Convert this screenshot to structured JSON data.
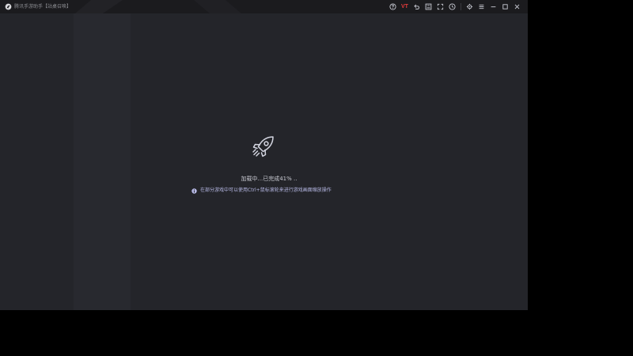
{
  "window": {
    "title": "腾讯手游助手【站桌召唤】",
    "colors": {
      "background": "#24252a",
      "title_bar": "#1b1b1e",
      "side_panel": "#28292f",
      "icon": "#c9cbd4",
      "vt_accent": "#e23b3b",
      "tip": "#b6b8e4"
    }
  },
  "toolbar": {
    "buttons": [
      {
        "name": "help-icon"
      },
      {
        "name": "vt-badge",
        "label": "VT"
      },
      {
        "name": "undo-icon"
      },
      {
        "name": "keyboard-icon"
      },
      {
        "name": "fullscreen-icon"
      },
      {
        "name": "record-icon"
      },
      {
        "name": "settings-icon"
      },
      {
        "name": "menu-icon"
      },
      {
        "name": "minimize-icon"
      },
      {
        "name": "maximize-icon"
      },
      {
        "name": "close-icon"
      }
    ]
  },
  "loading": {
    "icon": "rocket-icon",
    "status_text": "加载中...已完成41% ..",
    "progress_percent": 41,
    "tip_icon": "info-icon",
    "tip_text": "在部分游戏中可以使用Ctrl+鼠标滚轮来进行游戏画面缩放操作"
  }
}
